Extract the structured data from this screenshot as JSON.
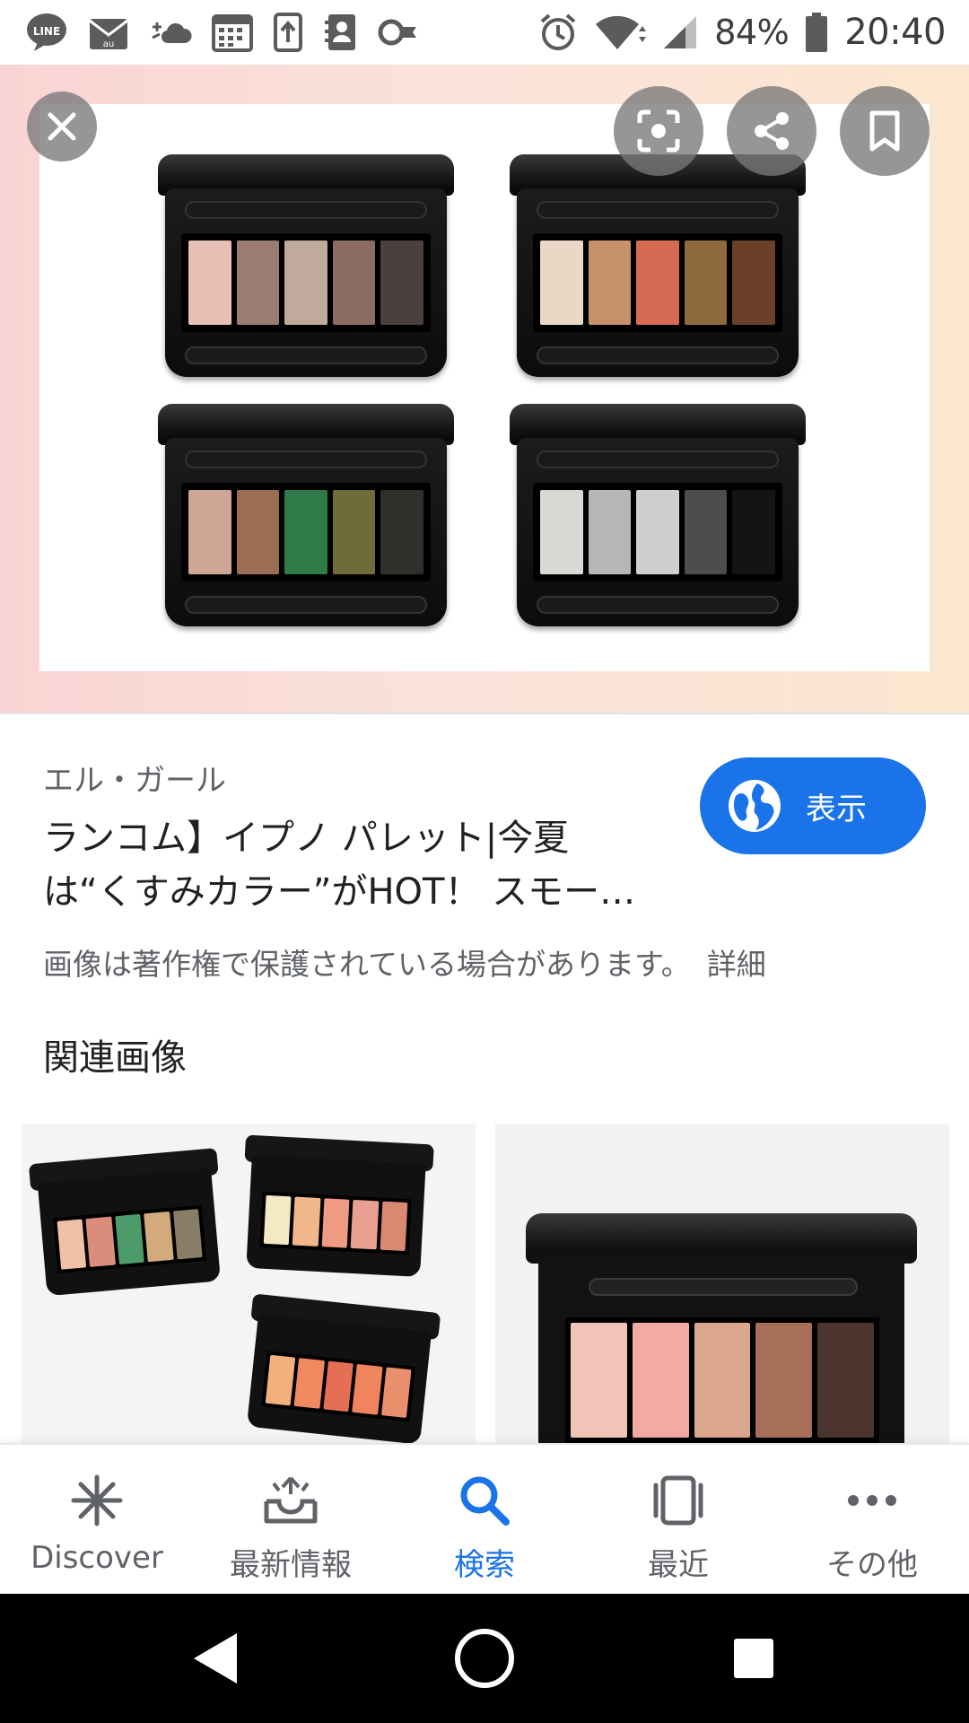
{
  "status_bar": {
    "left_icons": [
      "line-icon",
      "au-mail-icon",
      "weather-icon",
      "calendar-icon",
      "upload-icon",
      "contacts-icon",
      "key-icon"
    ],
    "right_icons": [
      "alarm-icon",
      "wifi-icon",
      "signal-icon",
      "battery-icon"
    ],
    "line_badge": "LINE",
    "battery": "84%",
    "time": "20:40"
  },
  "hero": {
    "close_icon": "close-icon",
    "actions": [
      "lens-icon",
      "share-icon",
      "bookmark-icon"
    ],
    "palettes": [
      {
        "pans": [
          "#e7bfb4",
          "#9a7c73",
          "#bfaa9c",
          "#8b6b62",
          "#4a413e"
        ]
      },
      {
        "pans": [
          "#e9d8c6",
          "#c6906a",
          "#d66a52",
          "#8e6a3d",
          "#6a4128"
        ]
      },
      {
        "pans": [
          "#cfa696",
          "#9b6d52",
          "#2f7a48",
          "#6e6c3a",
          "#2f302b"
        ]
      },
      {
        "pans": [
          "#d8d8d4",
          "#b6b6b4",
          "#cfcfcd",
          "#4d4d4d",
          "#141414"
        ]
      }
    ]
  },
  "result": {
    "source": "エル・ガール",
    "title_lines": [
      "ランコム】イプノ パレット|今夏",
      "は“くすみカラー”がHOT！ スモー…"
    ],
    "visit_label": "表示",
    "copyright_text": "画像は著作権で保護されている場合があります。",
    "details_label": "詳細"
  },
  "related": {
    "heading": "関連画像",
    "items": [
      {
        "palettes": [
          [
            "#f1c1a6",
            "#d98d7a",
            "#4d9b6a",
            "#d2aa7c",
            "#8a7d67"
          ],
          [
            "#f5e8c4",
            "#f0b78b",
            "#ef9a83",
            "#e9a091",
            "#d98872"
          ],
          [
            "#f3b07a",
            "#f08a5e",
            "#e56f55",
            "#ef845e",
            "#e8906b"
          ]
        ]
      },
      {
        "pans": [
          "#f2c4b8",
          "#f1aaa4",
          "#dca78f",
          "#a86f58",
          "#4c352e"
        ]
      }
    ]
  },
  "bottom_nav": {
    "items": [
      {
        "label": "Discover",
        "icon": "discover-icon",
        "active": false
      },
      {
        "label": "最新情報",
        "icon": "updates-icon",
        "active": false
      },
      {
        "label": "検索",
        "icon": "search-icon",
        "active": true
      },
      {
        "label": "最近",
        "icon": "recent-icon",
        "active": false
      },
      {
        "label": "その他",
        "icon": "more-icon",
        "active": false
      }
    ]
  },
  "colors": {
    "accent": "#1a73e8",
    "text_primary": "#202124",
    "text_secondary": "#5f6368"
  }
}
